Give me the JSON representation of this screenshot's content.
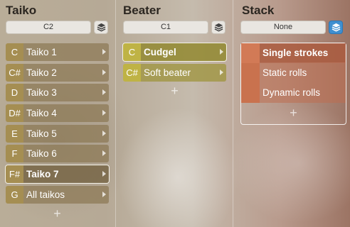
{
  "columns": {
    "taiko": {
      "title": "Taiko",
      "selector_value": "C2",
      "rows": [
        {
          "key": "C",
          "label": "Taiko 1"
        },
        {
          "key": "C#",
          "label": "Taiko 2"
        },
        {
          "key": "D",
          "label": "Taiko 3"
        },
        {
          "key": "D#",
          "label": "Taiko 4"
        },
        {
          "key": "E",
          "label": "Taiko 5"
        },
        {
          "key": "F",
          "label": "Taiko 6"
        },
        {
          "key": "F#",
          "label": "Taiko 7"
        },
        {
          "key": "G",
          "label": "All taikos"
        }
      ],
      "selected_row": "Taiko 7",
      "add_label": "+"
    },
    "beater": {
      "title": "Beater",
      "selector_value": "C1",
      "rows": [
        {
          "key": "C",
          "label": "Cudgel"
        },
        {
          "key": "C#",
          "label": "Soft beater"
        }
      ],
      "selected_row": "Cudgel",
      "add_label": "+"
    },
    "stack": {
      "title": "Stack",
      "selector_value": "None",
      "rows": [
        {
          "label": "Single strokes"
        },
        {
          "label": "Static rolls"
        },
        {
          "label": "Dynamic rolls"
        }
      ],
      "selected_row": "Single strokes",
      "add_label": "+",
      "stack_icon_active": true
    }
  },
  "icons": {
    "stack": "layers-icon",
    "row_arrow": "chevron-right-icon"
  },
  "colors": {
    "taiko_key": "#a58e52",
    "beater_key": "#bfb345",
    "stack_swatch": "#c9724e",
    "active_button": "#3e8fd0"
  }
}
